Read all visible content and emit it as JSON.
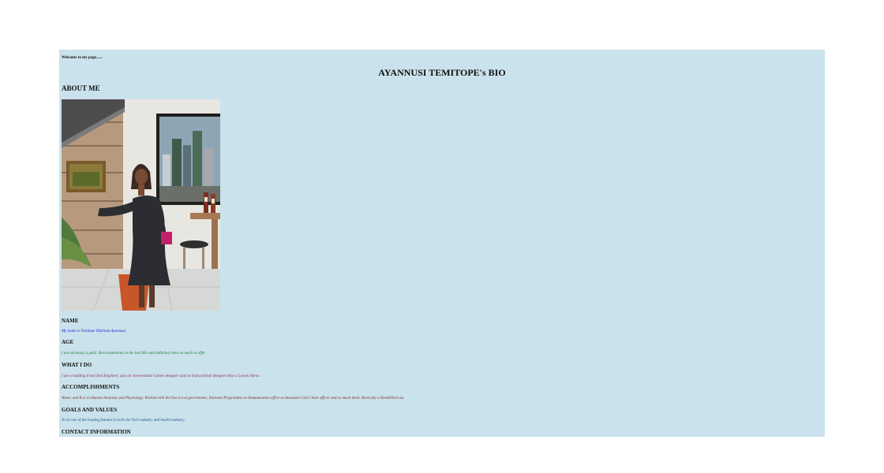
{
  "header": {
    "welcome": "Welcome to my page......",
    "title": "AYANNUSI TEMITOPE's BIO"
  },
  "about": {
    "heading": "ABOUT ME",
    "photo_alt": "Photo of Temitope standing in a room"
  },
  "sections": {
    "name": {
      "heading": "NAME",
      "text": "My name is Temitope Olabiola Ayannusi.",
      "color": "#1a1ad6"
    },
    "age": {
      "heading": "AGE",
      "text": "I am obviously a genZ. Born sometimes in the last 90's and definitely have so much to offer",
      "color": "#1f7a3a"
    },
    "what_i_do": {
      "heading": "WHAT I DO",
      "text": "I am a budding Front End Engineer, also an intermediate Games designer and an Instructional designer.Also a Locum Nurse.",
      "color": "#9b1f6e"
    },
    "accomplishments": {
      "heading": "ACCOMPLISHMENTS",
      "text": "Wassc and B.sc in Human Anatomy and Physiology. Worked with Ibi Oza Local government, National Programme on Immunization office as Assistant Cold Chain officer and so much more. Basically a HealthTech sis.",
      "color": "#7a2f2f"
    },
    "goals": {
      "heading": "GOALS AND VALUES",
      "text": "To be one of the leading females in both the Tech industry and health industry.",
      "color": "#1f4f8a"
    },
    "contact": {
      "heading": "CONTACT INFORMATION"
    }
  },
  "colors": {
    "panel_background": "#cae2eb",
    "page_background": "#ffffff"
  }
}
